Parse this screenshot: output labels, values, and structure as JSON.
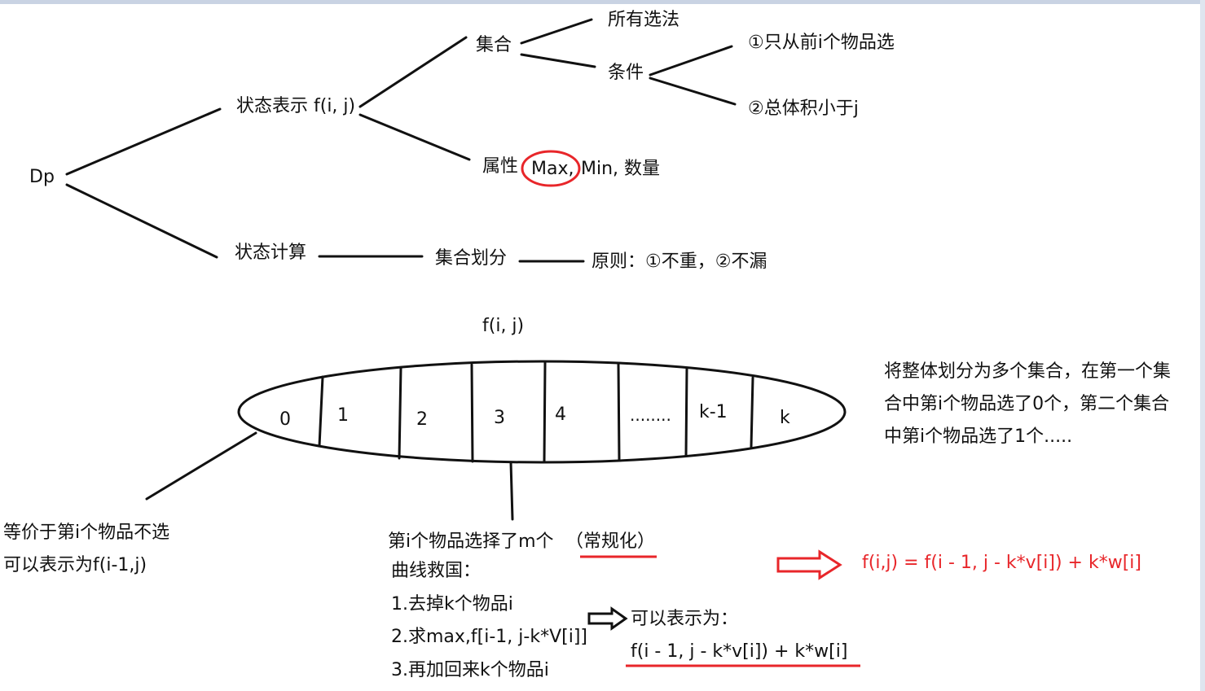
{
  "tree": {
    "root": "Dp",
    "state_repr": "状态表示 f(i, j)",
    "set": "集合",
    "all_choices": "所有选法",
    "conditions": "条件",
    "cond1": "①只从前i个物品选",
    "cond2": "②总体积小于j",
    "attr_label": "属性",
    "attr_max": "Max,",
    "attr_rest": "Min, 数量",
    "state_calc": "状态计算",
    "partition": "集合划分",
    "principle": "原则：①不重，②不漏"
  },
  "ellipse": {
    "title": "f(i, j)",
    "cells": [
      "0",
      "1",
      "2",
      "3",
      "4",
      "........",
      "k-1",
      "k"
    ]
  },
  "notes": {
    "right_desc": [
      "将整体划分为多个集合，在第一个集",
      "合中第i个物品选了0个，第二个集合",
      "中第i个物品选了1个....."
    ],
    "left_line1": "等价于第i个物品不选",
    "left_line2": "可以表示为f(i-1,j)",
    "mid_line1": "第i个物品选择了m个",
    "mid_paren": "（常规化）",
    "steps": [
      "曲线救国：",
      "1.去掉k个物品i",
      "2.求max,f[i-1, j-k*V[i]]",
      "3.再加回来k个物品i"
    ],
    "can_repr": "可以表示为：",
    "formula1": "f(i - 1, j - k*v[i]) + k*w[i]",
    "formula_red": "f(i,j) = f(i - 1, j - k*v[i]) + k*w[i]"
  },
  "colors": {
    "ink": "#111111",
    "accent": "#e8262a"
  }
}
